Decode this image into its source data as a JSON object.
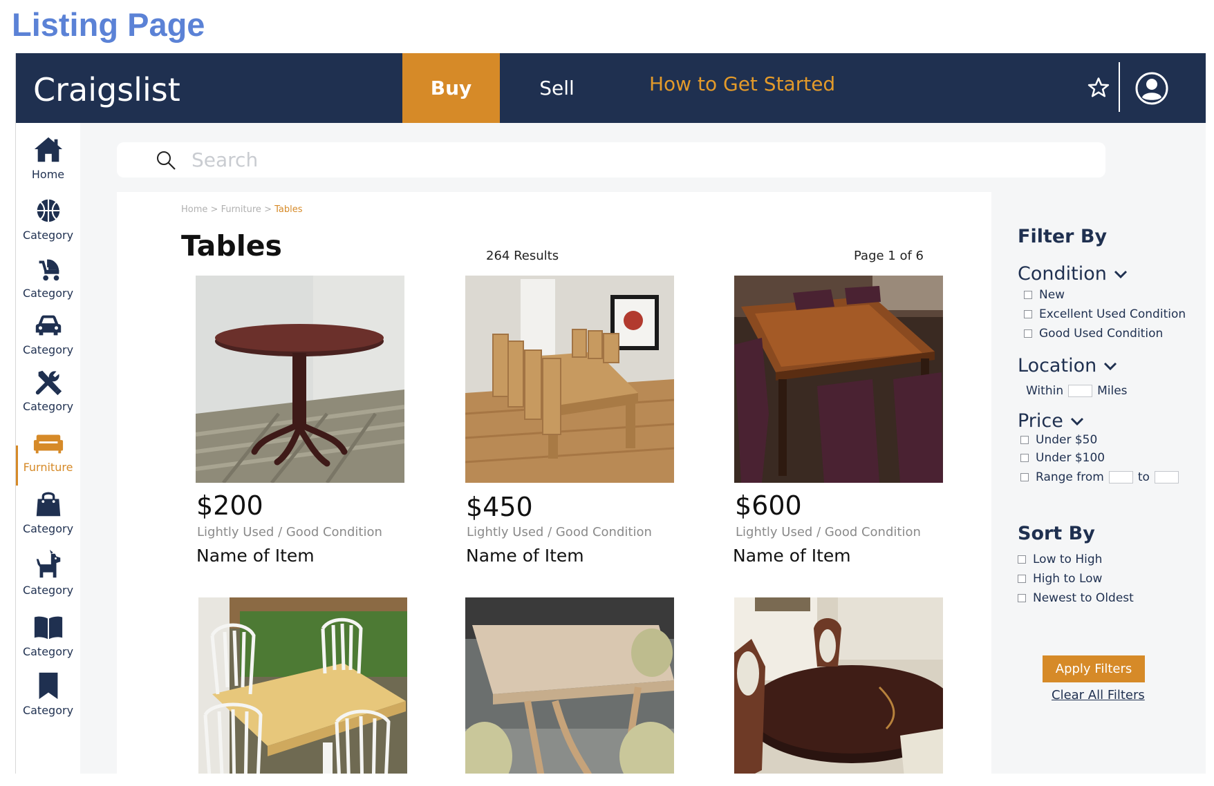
{
  "page_label": "Listing Page",
  "header": {
    "brand": "Craigslist",
    "nav": {
      "buy": "Buy",
      "sell": "Sell",
      "how_to": "How to Get Started"
    },
    "colors": {
      "navy": "#1f3050",
      "orange": "#d68a28",
      "link_orange": "#e39a2a"
    }
  },
  "sidebar": {
    "items": [
      {
        "label": "Home",
        "icon": "home-icon"
      },
      {
        "label": "Category",
        "icon": "basketball-icon"
      },
      {
        "label": "Category",
        "icon": "stroller-icon"
      },
      {
        "label": "Category",
        "icon": "car-icon"
      },
      {
        "label": "Category",
        "icon": "tools-icon"
      },
      {
        "label": "Furniture",
        "icon": "sofa-icon",
        "active": true
      },
      {
        "label": "Category",
        "icon": "shopping-bag-icon"
      },
      {
        "label": "Category",
        "icon": "dog-icon"
      },
      {
        "label": "Category",
        "icon": "book-icon"
      },
      {
        "label": "Category",
        "icon": "bookmark-icon"
      }
    ]
  },
  "search": {
    "placeholder": "Search"
  },
  "breadcrumb": {
    "home": "Home",
    "furniture": "Furniture",
    "current": "Tables",
    "sep": " > "
  },
  "listing": {
    "title": "Tables",
    "results": "264 Results",
    "page": "Page 1 of 6",
    "items": [
      {
        "price": "$200",
        "condition": "Lightly Used / Good Condition",
        "name": "Name of Item"
      },
      {
        "price": "$450",
        "condition": "Lightly Used / Good Condition",
        "name": "Name of Item"
      },
      {
        "price": "$600",
        "condition": "Lightly Used / Good Condition",
        "name": "Name of Item"
      },
      {
        "price": "",
        "condition": "",
        "name": ""
      },
      {
        "price": "",
        "condition": "",
        "name": ""
      },
      {
        "price": "",
        "condition": "",
        "name": ""
      }
    ]
  },
  "filters": {
    "title": "Filter By",
    "condition": {
      "label": "Condition",
      "options": [
        "New",
        "Excellent Used Condition",
        "Good Used Condition"
      ]
    },
    "location": {
      "label": "Location",
      "within": "Within",
      "miles": "Miles"
    },
    "price": {
      "label": "Price",
      "options": [
        "Under $50",
        "Under $100"
      ],
      "range_from": "Range from",
      "to": "to"
    },
    "sort": {
      "title": "Sort By",
      "options": [
        "Low to High",
        "High to Low",
        "Newest to Oldest"
      ]
    },
    "apply": "Apply Filters",
    "clear": "Clear All Filters"
  }
}
